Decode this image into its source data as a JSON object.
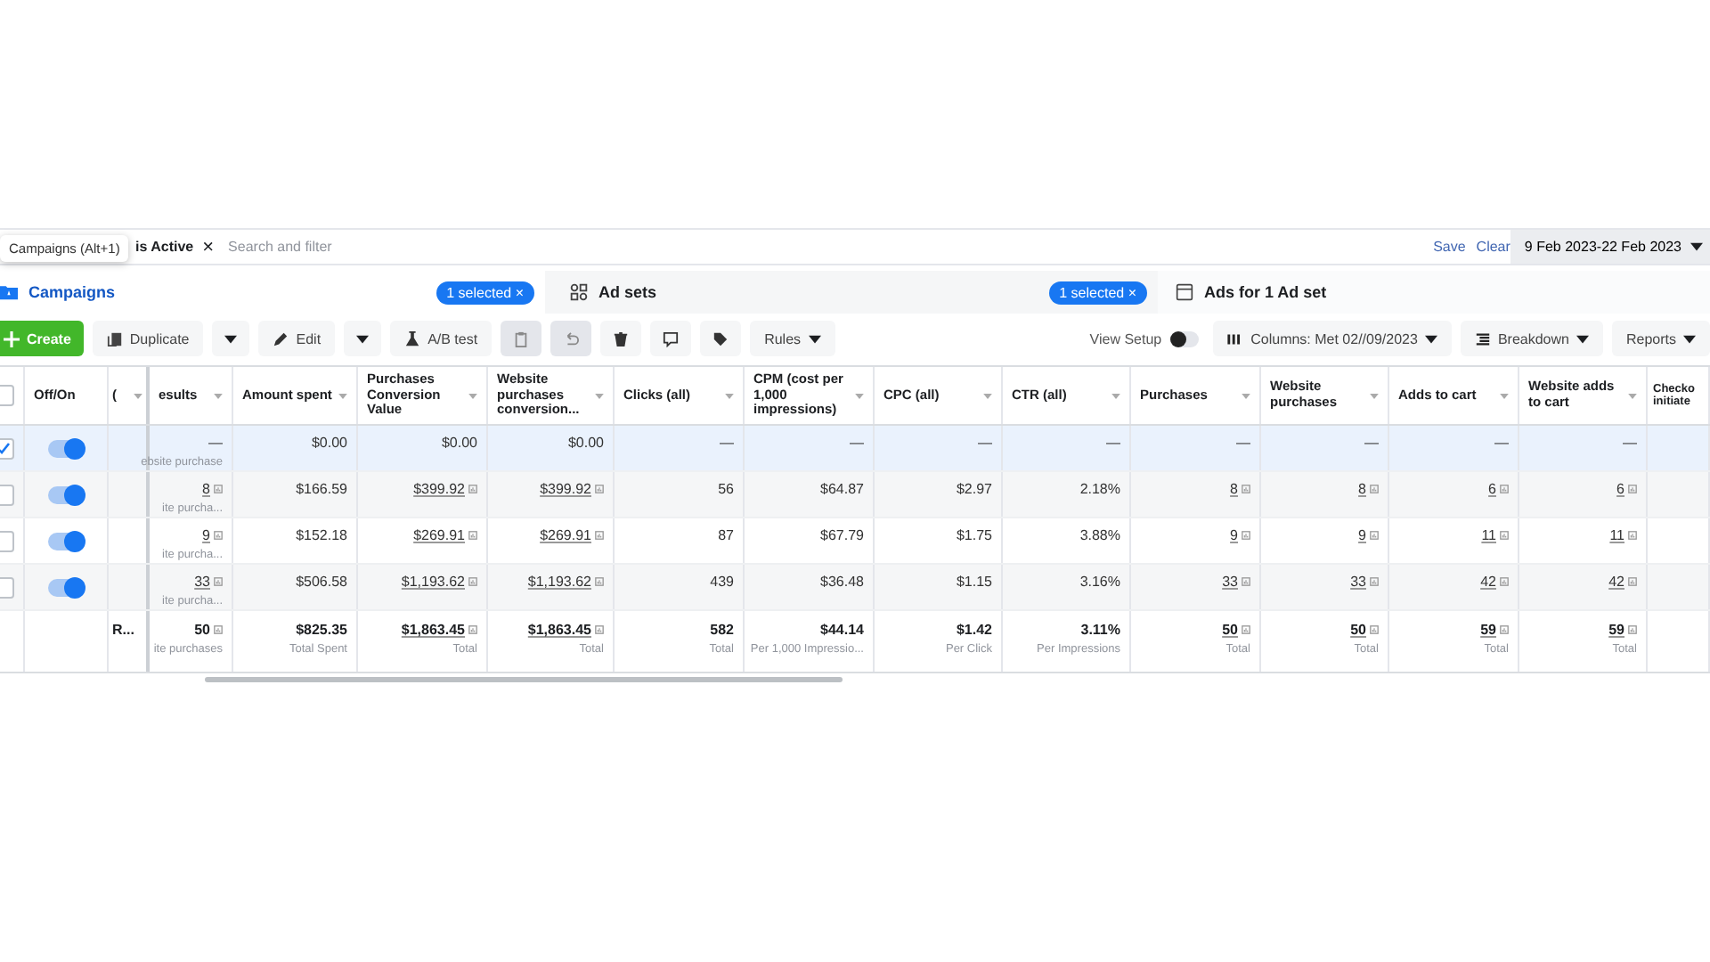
{
  "filter": {
    "chip": "is Active",
    "chip_close": "×",
    "placeholder": "Search and filter",
    "save": "Save",
    "clear": "Clear",
    "date": "9 Feb 2023-22 Feb 2023"
  },
  "tooltip": "Campaigns (Alt+1)",
  "tabs": [
    {
      "label": "Campaigns",
      "kind": "folder",
      "selected": true,
      "badge": "1 selected",
      "badge_close": "×"
    },
    {
      "label": "Ad sets",
      "kind": "grid",
      "selected": false,
      "badge": "1 selected",
      "badge_close": "×"
    },
    {
      "label": "Ads for 1 Ad set",
      "kind": "page",
      "selected": false
    }
  ],
  "toolbar": [
    {
      "kind": "create",
      "label": "Create"
    },
    {
      "kind": "duplicate",
      "label": "Duplicate"
    },
    {
      "kind": "caret"
    },
    {
      "kind": "edit",
      "label": "Edit"
    },
    {
      "kind": "caret"
    },
    {
      "kind": "abtest",
      "label": "A/B test"
    },
    {
      "kind": "clipboard",
      "disabled": true
    },
    {
      "kind": "undo",
      "disabled": true
    },
    {
      "kind": "trash",
      "disabled": false
    },
    {
      "kind": "comment",
      "disabled": false
    },
    {
      "kind": "tag",
      "disabled": false
    },
    {
      "kind": "menu",
      "label": "Rules"
    }
  ],
  "view_setup": {
    "label": "View Setup",
    "on": false
  },
  "toolbar_right": [
    {
      "kind": "columns",
      "label": "Columns: Met 02//09/2023"
    },
    {
      "kind": "breakdown",
      "label": "Breakdown"
    },
    {
      "kind": "reports",
      "label": "Reports"
    }
  ],
  "table": {
    "select_all": false,
    "toggle_header": "Off/On",
    "columns": [
      "(",
      "esults",
      "Amount spent",
      "Purchases Conversion Value",
      "Website purchases conversion...",
      "Clicks (all)",
      "CPM (cost per 1,000 impressions)",
      "CPC (all)",
      "CTR (all)",
      "Purchases",
      "Website purchases",
      "Adds to cart",
      "Website adds to cart",
      "Checko initiate"
    ],
    "rows": [
      {
        "selected": true,
        "on": true,
        "cells": [
          {
            "text": ""
          },
          {
            "text": "—",
            "note": "ebsite purchase"
          },
          {
            "text": "$0.00"
          },
          {
            "text": "$0.00"
          },
          {
            "text": "$0.00"
          },
          {
            "text": "—"
          },
          {
            "text": "—"
          },
          {
            "text": "—"
          },
          {
            "text": "—"
          },
          {
            "text": "—"
          },
          {
            "text": "—"
          },
          {
            "text": "—"
          },
          {
            "text": "—"
          }
        ]
      },
      {
        "selected": false,
        "on": true,
        "cells": [
          {
            "text": ""
          },
          {
            "text": "8",
            "link": true,
            "icon": true,
            "note": "ite purcha..."
          },
          {
            "text": "$166.59"
          },
          {
            "text": "$399.92",
            "link": true,
            "icon": true
          },
          {
            "text": "$399.92",
            "link": true,
            "icon": true
          },
          {
            "text": "56"
          },
          {
            "text": "$64.87"
          },
          {
            "text": "$2.97"
          },
          {
            "text": "2.18%"
          },
          {
            "text": "8",
            "link": true,
            "icon": true
          },
          {
            "text": "8",
            "link": true,
            "icon": true
          },
          {
            "text": "6",
            "link": true,
            "icon": true
          },
          {
            "text": "6",
            "link": true,
            "icon": true
          }
        ]
      },
      {
        "selected": false,
        "on": true,
        "cells": [
          {
            "text": ""
          },
          {
            "text": "9",
            "link": true,
            "icon": true,
            "note": "ite purcha..."
          },
          {
            "text": "$152.18"
          },
          {
            "text": "$269.91",
            "link": true,
            "icon": true
          },
          {
            "text": "$269.91",
            "link": true,
            "icon": true
          },
          {
            "text": "87"
          },
          {
            "text": "$67.79"
          },
          {
            "text": "$1.75"
          },
          {
            "text": "3.88%"
          },
          {
            "text": "9",
            "link": true,
            "icon": true
          },
          {
            "text": "9",
            "link": true,
            "icon": true
          },
          {
            "text": "11",
            "link": true,
            "icon": true
          },
          {
            "text": "11",
            "link": true,
            "icon": true
          }
        ]
      },
      {
        "selected": false,
        "on": true,
        "cells": [
          {
            "text": ""
          },
          {
            "text": "33",
            "link": true,
            "icon": true,
            "note": "ite purcha..."
          },
          {
            "text": "$506.58"
          },
          {
            "text": "$1,193.62",
            "link": true,
            "icon": true
          },
          {
            "text": "$1,193.62",
            "link": true,
            "icon": true
          },
          {
            "text": "439"
          },
          {
            "text": "$36.48"
          },
          {
            "text": "$1.15"
          },
          {
            "text": "3.16%"
          },
          {
            "text": "33",
            "link": true,
            "icon": true
          },
          {
            "text": "33",
            "link": true,
            "icon": true
          },
          {
            "text": "42",
            "link": true,
            "icon": true
          },
          {
            "text": "42",
            "link": true,
            "icon": true
          }
        ]
      }
    ],
    "totals": {
      "cells": [
        {
          "text": "R..."
        },
        {
          "text": "50",
          "icon": true,
          "note": "ite purchases"
        },
        {
          "text": "$825.35",
          "note": "Total Spent"
        },
        {
          "text": "$1,863.45",
          "link": true,
          "icon": true,
          "note": "Total"
        },
        {
          "text": "$1,863.45",
          "link": true,
          "icon": true,
          "note": "Total"
        },
        {
          "text": "582",
          "note": "Total"
        },
        {
          "text": "$44.14",
          "note": "Per 1,000 Impressio..."
        },
        {
          "text": "$1.42",
          "note": "Per Click"
        },
        {
          "text": "3.11%",
          "note": "Per Impressions"
        },
        {
          "text": "50",
          "link": true,
          "icon": true,
          "note": "Total"
        },
        {
          "text": "50",
          "link": true,
          "icon": true,
          "note": "Total"
        },
        {
          "text": "59",
          "link": true,
          "icon": true,
          "note": "Total"
        },
        {
          "text": "59",
          "link": true,
          "icon": true,
          "note": "Total"
        }
      ]
    }
  }
}
